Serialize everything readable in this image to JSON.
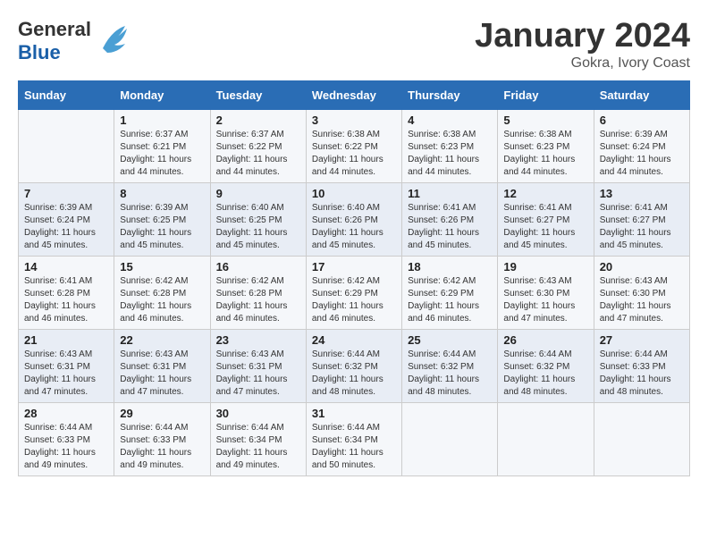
{
  "header": {
    "logo_line1": "General",
    "logo_line2": "Blue",
    "month_title": "January 2024",
    "subtitle": "Gokra, Ivory Coast"
  },
  "days_of_week": [
    "Sunday",
    "Monday",
    "Tuesday",
    "Wednesday",
    "Thursday",
    "Friday",
    "Saturday"
  ],
  "weeks": [
    [
      {
        "day": "",
        "sunrise": "",
        "sunset": "",
        "daylight": ""
      },
      {
        "day": "1",
        "sunrise": "Sunrise: 6:37 AM",
        "sunset": "Sunset: 6:21 PM",
        "daylight": "Daylight: 11 hours and 44 minutes."
      },
      {
        "day": "2",
        "sunrise": "Sunrise: 6:37 AM",
        "sunset": "Sunset: 6:22 PM",
        "daylight": "Daylight: 11 hours and 44 minutes."
      },
      {
        "day": "3",
        "sunrise": "Sunrise: 6:38 AM",
        "sunset": "Sunset: 6:22 PM",
        "daylight": "Daylight: 11 hours and 44 minutes."
      },
      {
        "day": "4",
        "sunrise": "Sunrise: 6:38 AM",
        "sunset": "Sunset: 6:23 PM",
        "daylight": "Daylight: 11 hours and 44 minutes."
      },
      {
        "day": "5",
        "sunrise": "Sunrise: 6:38 AM",
        "sunset": "Sunset: 6:23 PM",
        "daylight": "Daylight: 11 hours and 44 minutes."
      },
      {
        "day": "6",
        "sunrise": "Sunrise: 6:39 AM",
        "sunset": "Sunset: 6:24 PM",
        "daylight": "Daylight: 11 hours and 44 minutes."
      }
    ],
    [
      {
        "day": "7",
        "sunrise": "Sunrise: 6:39 AM",
        "sunset": "Sunset: 6:24 PM",
        "daylight": "Daylight: 11 hours and 45 minutes."
      },
      {
        "day": "8",
        "sunrise": "Sunrise: 6:39 AM",
        "sunset": "Sunset: 6:25 PM",
        "daylight": "Daylight: 11 hours and 45 minutes."
      },
      {
        "day": "9",
        "sunrise": "Sunrise: 6:40 AM",
        "sunset": "Sunset: 6:25 PM",
        "daylight": "Daylight: 11 hours and 45 minutes."
      },
      {
        "day": "10",
        "sunrise": "Sunrise: 6:40 AM",
        "sunset": "Sunset: 6:26 PM",
        "daylight": "Daylight: 11 hours and 45 minutes."
      },
      {
        "day": "11",
        "sunrise": "Sunrise: 6:41 AM",
        "sunset": "Sunset: 6:26 PM",
        "daylight": "Daylight: 11 hours and 45 minutes."
      },
      {
        "day": "12",
        "sunrise": "Sunrise: 6:41 AM",
        "sunset": "Sunset: 6:27 PM",
        "daylight": "Daylight: 11 hours and 45 minutes."
      },
      {
        "day": "13",
        "sunrise": "Sunrise: 6:41 AM",
        "sunset": "Sunset: 6:27 PM",
        "daylight": "Daylight: 11 hours and 45 minutes."
      }
    ],
    [
      {
        "day": "14",
        "sunrise": "Sunrise: 6:41 AM",
        "sunset": "Sunset: 6:28 PM",
        "daylight": "Daylight: 11 hours and 46 minutes."
      },
      {
        "day": "15",
        "sunrise": "Sunrise: 6:42 AM",
        "sunset": "Sunset: 6:28 PM",
        "daylight": "Daylight: 11 hours and 46 minutes."
      },
      {
        "day": "16",
        "sunrise": "Sunrise: 6:42 AM",
        "sunset": "Sunset: 6:28 PM",
        "daylight": "Daylight: 11 hours and 46 minutes."
      },
      {
        "day": "17",
        "sunrise": "Sunrise: 6:42 AM",
        "sunset": "Sunset: 6:29 PM",
        "daylight": "Daylight: 11 hours and 46 minutes."
      },
      {
        "day": "18",
        "sunrise": "Sunrise: 6:42 AM",
        "sunset": "Sunset: 6:29 PM",
        "daylight": "Daylight: 11 hours and 46 minutes."
      },
      {
        "day": "19",
        "sunrise": "Sunrise: 6:43 AM",
        "sunset": "Sunset: 6:30 PM",
        "daylight": "Daylight: 11 hours and 47 minutes."
      },
      {
        "day": "20",
        "sunrise": "Sunrise: 6:43 AM",
        "sunset": "Sunset: 6:30 PM",
        "daylight": "Daylight: 11 hours and 47 minutes."
      }
    ],
    [
      {
        "day": "21",
        "sunrise": "Sunrise: 6:43 AM",
        "sunset": "Sunset: 6:31 PM",
        "daylight": "Daylight: 11 hours and 47 minutes."
      },
      {
        "day": "22",
        "sunrise": "Sunrise: 6:43 AM",
        "sunset": "Sunset: 6:31 PM",
        "daylight": "Daylight: 11 hours and 47 minutes."
      },
      {
        "day": "23",
        "sunrise": "Sunrise: 6:43 AM",
        "sunset": "Sunset: 6:31 PM",
        "daylight": "Daylight: 11 hours and 47 minutes."
      },
      {
        "day": "24",
        "sunrise": "Sunrise: 6:44 AM",
        "sunset": "Sunset: 6:32 PM",
        "daylight": "Daylight: 11 hours and 48 minutes."
      },
      {
        "day": "25",
        "sunrise": "Sunrise: 6:44 AM",
        "sunset": "Sunset: 6:32 PM",
        "daylight": "Daylight: 11 hours and 48 minutes."
      },
      {
        "day": "26",
        "sunrise": "Sunrise: 6:44 AM",
        "sunset": "Sunset: 6:32 PM",
        "daylight": "Daylight: 11 hours and 48 minutes."
      },
      {
        "day": "27",
        "sunrise": "Sunrise: 6:44 AM",
        "sunset": "Sunset: 6:33 PM",
        "daylight": "Daylight: 11 hours and 48 minutes."
      }
    ],
    [
      {
        "day": "28",
        "sunrise": "Sunrise: 6:44 AM",
        "sunset": "Sunset: 6:33 PM",
        "daylight": "Daylight: 11 hours and 49 minutes."
      },
      {
        "day": "29",
        "sunrise": "Sunrise: 6:44 AM",
        "sunset": "Sunset: 6:33 PM",
        "daylight": "Daylight: 11 hours and 49 minutes."
      },
      {
        "day": "30",
        "sunrise": "Sunrise: 6:44 AM",
        "sunset": "Sunset: 6:34 PM",
        "daylight": "Daylight: 11 hours and 49 minutes."
      },
      {
        "day": "31",
        "sunrise": "Sunrise: 6:44 AM",
        "sunset": "Sunset: 6:34 PM",
        "daylight": "Daylight: 11 hours and 50 minutes."
      },
      {
        "day": "",
        "sunrise": "",
        "sunset": "",
        "daylight": ""
      },
      {
        "day": "",
        "sunrise": "",
        "sunset": "",
        "daylight": ""
      },
      {
        "day": "",
        "sunrise": "",
        "sunset": "",
        "daylight": ""
      }
    ]
  ]
}
